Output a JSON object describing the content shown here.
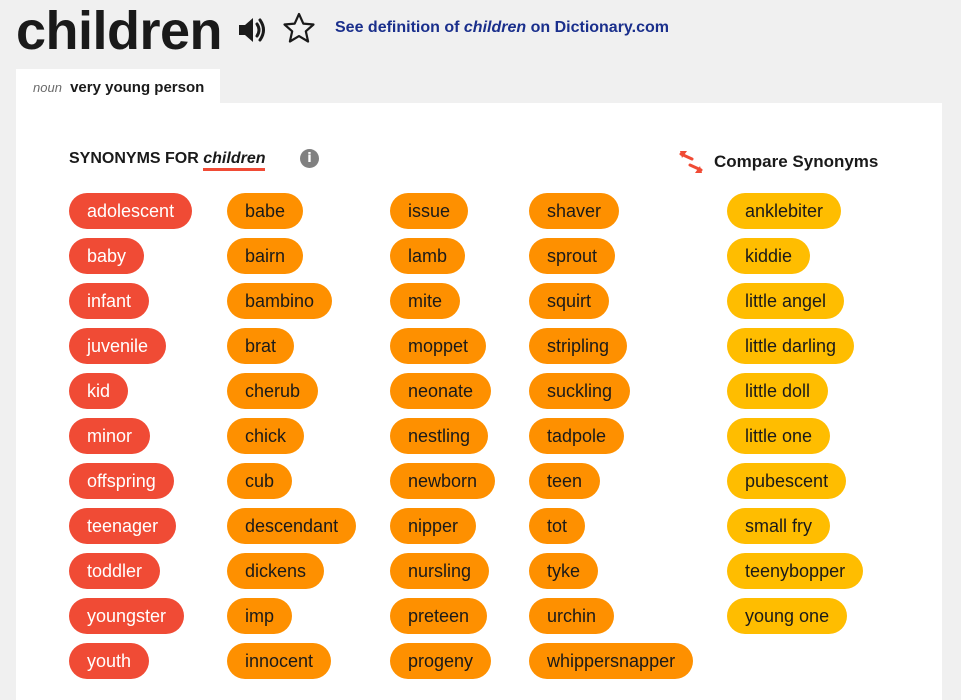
{
  "headword": "children",
  "dictionary_link": {
    "prefix": "See definition of",
    "word": "children",
    "suffix": "on Dictionary.com"
  },
  "sense_tab": {
    "pos": "noun",
    "definition": "very young person"
  },
  "synonyms_heading": {
    "label": "SYNONYMS FOR",
    "word": "children"
  },
  "info_icon": "i",
  "compare_label": "Compare Synonyms",
  "colors": {
    "red": "#f04b35",
    "orange": "#fe9000",
    "yellow": "#ffbd00",
    "link": "#1a2f8c"
  },
  "icons": [
    "speaker-icon",
    "star-icon",
    "info-icon",
    "compare-arrows-icon"
  ],
  "columns": [
    {
      "color": "red",
      "words": [
        "adolescent",
        "baby",
        "infant",
        "juvenile",
        "kid",
        "minor",
        "offspring",
        "teenager",
        "toddler",
        "youngster",
        "youth"
      ]
    },
    {
      "color": "orange",
      "words": [
        "babe",
        "bairn",
        "bambino",
        "brat",
        "cherub",
        "chick",
        "cub",
        "descendant",
        "dickens",
        "imp",
        "innocent"
      ]
    },
    {
      "color": "orange",
      "words": [
        "issue",
        "lamb",
        "mite",
        "moppet",
        "neonate",
        "nestling",
        "newborn",
        "nipper",
        "nursling",
        "preteen",
        "progeny"
      ]
    },
    {
      "color": "orange",
      "words": [
        "shaver",
        "sprout",
        "squirt",
        "stripling",
        "suckling",
        "tadpole",
        "teen",
        "tot",
        "tyke",
        "urchin",
        "whippersnapper"
      ]
    },
    {
      "color": "yellow",
      "words": [
        "anklebiter",
        "kiddie",
        "little angel",
        "little darling",
        "little doll",
        "little one",
        "pubescent",
        "small fry",
        "teenybopper",
        "young one"
      ]
    }
  ]
}
